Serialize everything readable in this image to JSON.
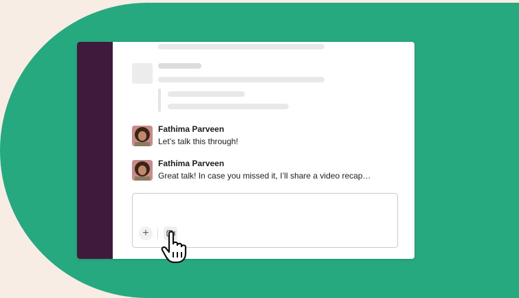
{
  "messages": [
    {
      "author": "Fathima Parveen",
      "text": "Let’s talk this through!"
    },
    {
      "author": "Fathima Parveen",
      "text": "Great talk! In case you missed it, I’ll share a video recap…"
    }
  ],
  "composer": {
    "plus_icon": "+"
  },
  "colors": {
    "background": "#f7ede4",
    "green": "#26a97f",
    "sidebar": "#3f1a3d"
  },
  "icons": [
    "plus-icon",
    "video-clip-icon",
    "hand-pointer-icon"
  ]
}
